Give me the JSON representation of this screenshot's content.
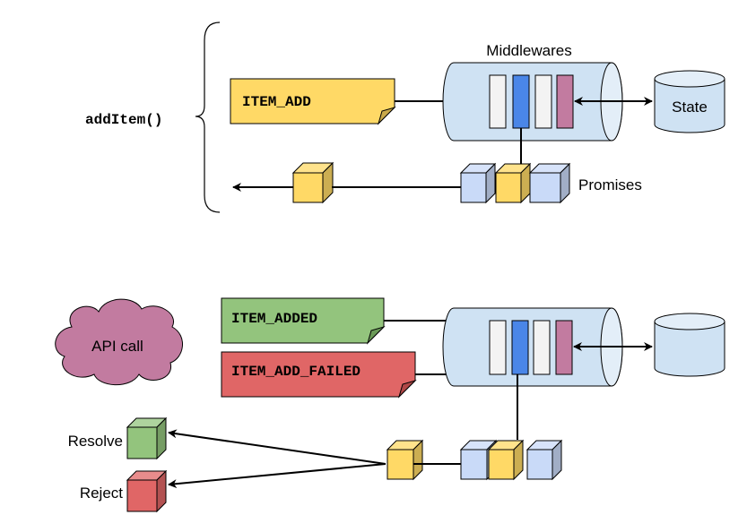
{
  "top": {
    "function_label": "addItem()",
    "action_note": "ITEM_ADD",
    "middlewares_label": "Middlewares",
    "state_label": "State",
    "promises_label": "Promises"
  },
  "bottom": {
    "cloud_label": "API call",
    "success_note": "ITEM_ADDED",
    "failure_note": "ITEM_ADD_FAILED",
    "resolve_label": "Resolve",
    "reject_label": "Reject"
  },
  "colors": {
    "yellow": "#ffd966",
    "green": "#93c47d",
    "red": "#e06666",
    "pipe": "#cfe2f3",
    "middleware_blue": "#4a86e8",
    "middleware_pink": "#c27ba0",
    "middleware_white": "#f3f3f3",
    "promise_blue": "#c9daf8",
    "cloud": "#c27ba0"
  }
}
